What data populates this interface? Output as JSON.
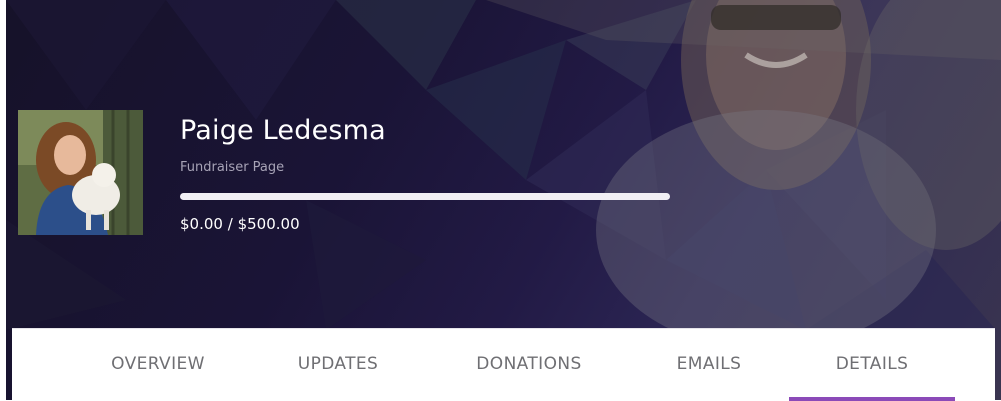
{
  "profile": {
    "name": "Paige Ledesma",
    "subtitle": "Fundraiser Page",
    "raised": "$0.00",
    "separator": "/",
    "goal": "$500.00",
    "progress_fraction": 0.0
  },
  "tabs": [
    {
      "label": "OVERVIEW",
      "active": false
    },
    {
      "label": "UPDATES",
      "active": false
    },
    {
      "label": "DONATIONS",
      "active": false
    },
    {
      "label": "EMAILS",
      "active": false
    },
    {
      "label": "DETAILS",
      "active": true
    }
  ],
  "colors": {
    "accent": "#8b4ab8",
    "hero_bg": "#161229",
    "tab_text": "#6f6f73"
  }
}
